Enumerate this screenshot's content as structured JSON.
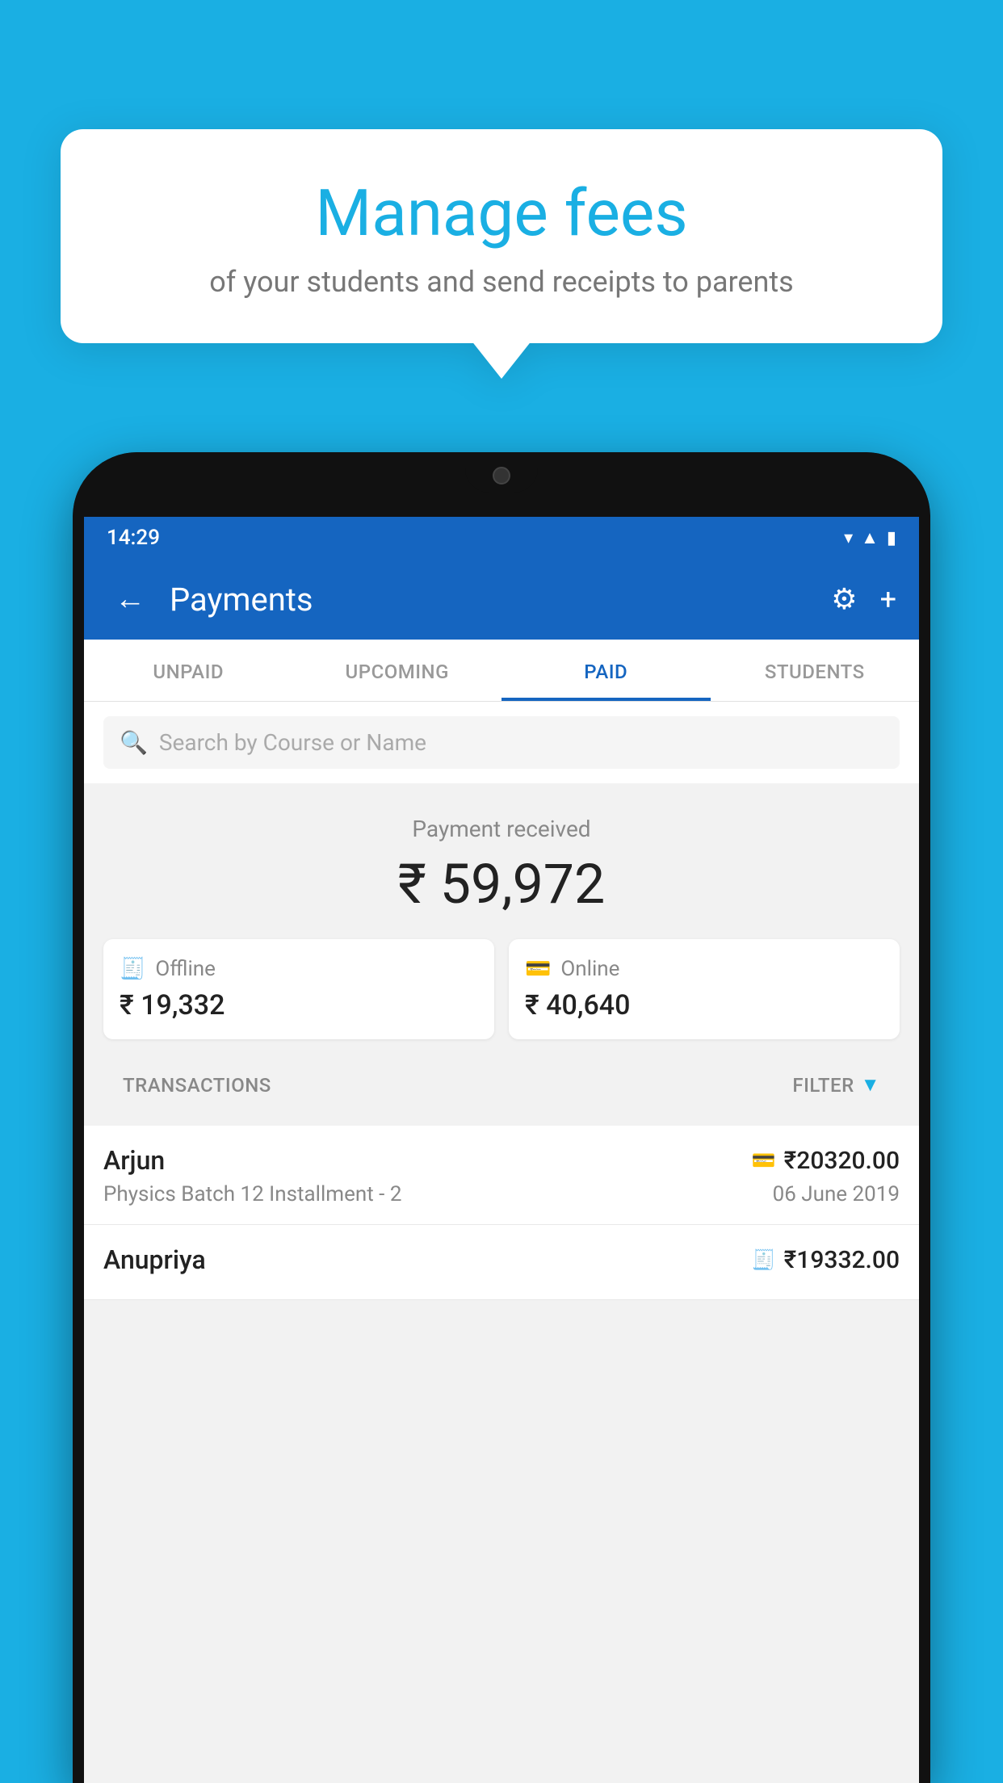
{
  "background_color": "#1AAFE3",
  "bubble": {
    "title": "Manage fees",
    "subtitle": "of your students and send receipts to parents"
  },
  "status_bar": {
    "time": "14:29",
    "icons": [
      "wifi",
      "signal",
      "battery"
    ]
  },
  "header": {
    "title": "Payments",
    "back_label": "←",
    "settings_label": "⚙",
    "add_label": "+"
  },
  "tabs": [
    {
      "label": "UNPAID",
      "active": false
    },
    {
      "label": "UPCOMING",
      "active": false
    },
    {
      "label": "PAID",
      "active": true
    },
    {
      "label": "STUDENTS",
      "active": false
    }
  ],
  "search": {
    "placeholder": "Search by Course or Name"
  },
  "payment_summary": {
    "label": "Payment received",
    "total": "₹ 59,972",
    "offline": {
      "icon": "💳",
      "label": "Offline",
      "amount": "₹ 19,332"
    },
    "online": {
      "icon": "💳",
      "label": "Online",
      "amount": "₹ 40,640"
    }
  },
  "transactions_section": {
    "label": "TRANSACTIONS",
    "filter_label": "FILTER"
  },
  "transactions": [
    {
      "name": "Arjun",
      "course": "Physics Batch 12 Installment - 2",
      "amount": "₹20320.00",
      "date": "06 June 2019",
      "type": "online"
    },
    {
      "name": "Anupriya",
      "course": "",
      "amount": "₹19332.00",
      "date": "",
      "type": "offline"
    }
  ]
}
